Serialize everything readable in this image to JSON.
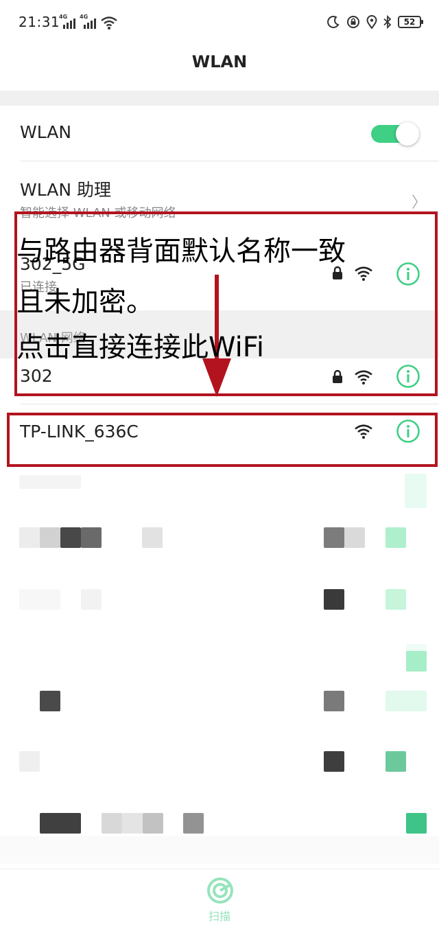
{
  "status_bar": {
    "time": "21:31",
    "signal_labels": [
      "4G",
      "4G"
    ],
    "battery": "52",
    "icons": [
      "moon-icon",
      "lock-rotation-icon",
      "location-icon",
      "bluetooth-icon",
      "battery-icon"
    ]
  },
  "header": {
    "title": "WLAN"
  },
  "wlan_toggle": {
    "label": "WLAN",
    "state": "on"
  },
  "assistant": {
    "label": "WLAN 助理",
    "subtitle": "智能选择 WLAN 或移动网络"
  },
  "connected_network": {
    "name": "302_5G",
    "status": "已连接"
  },
  "networks_section": {
    "title": "WLAN 网络"
  },
  "networks": [
    {
      "name": "302",
      "secured": true
    },
    {
      "name": "TP-LINK_636C",
      "secured": false
    }
  ],
  "annotation": {
    "line1": "与路由器背面默认名称一致",
    "line2": "且未加密。",
    "line3": "点击直接连接此WiFi"
  },
  "bottom": {
    "scan_label": "扫描"
  },
  "colors": {
    "accent": "#3fcf85",
    "annotation_red": "#b3131f"
  }
}
